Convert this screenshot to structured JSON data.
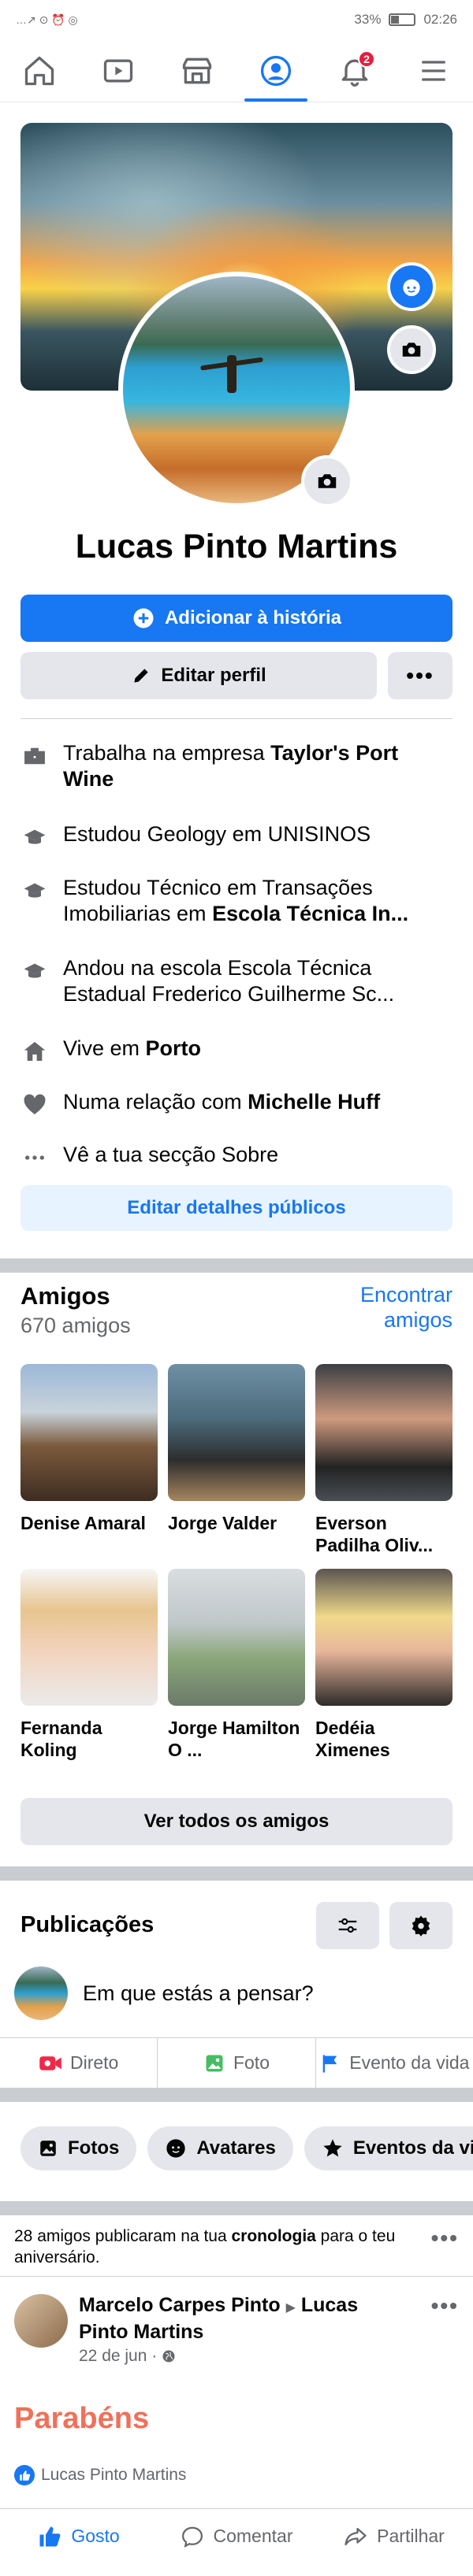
{
  "status_bar": {
    "battery": "33%",
    "time": "02:26",
    "left_icons": "…↗ ⊙ ⏰ ◎"
  },
  "nav": {
    "items": [
      {
        "name": "home",
        "icon": "home-icon"
      },
      {
        "name": "watch",
        "icon": "video-icon"
      },
      {
        "name": "marketplace",
        "icon": "shop-icon"
      },
      {
        "name": "profile",
        "icon": "profile-icon",
        "active": true
      },
      {
        "name": "notifications",
        "icon": "bell-icon",
        "badge": "2"
      },
      {
        "name": "menu",
        "icon": "hamburger-icon"
      }
    ]
  },
  "profile": {
    "name": "Lucas Pinto Martins",
    "add_story_label": "Adicionar à história",
    "edit_profile_label": "Editar perfil",
    "more_label": "•••"
  },
  "details": {
    "work": {
      "prefix": "Trabalha na empresa ",
      "bold": "Taylor's Port Wine"
    },
    "study1": {
      "prefix": "Estudou Geology em UNISINOS",
      "bold": ""
    },
    "study2": {
      "prefix": "Estudou Técnico em Transações Imobiliarias em ",
      "bold": "Escola Técnica In..."
    },
    "school": {
      "prefix": "Andou na escola Escola Técnica Estadual Frederico Guilherme Sc...",
      "bold": ""
    },
    "lives": {
      "prefix": "Vive em ",
      "bold": "Porto"
    },
    "relationship": {
      "prefix": "Numa relação com ",
      "bold": "Michelle Huff"
    },
    "about": {
      "prefix": "Vê a tua secção Sobre",
      "bold": ""
    },
    "edit_public_label": "Editar detalhes públicos"
  },
  "friends": {
    "title": "Amigos",
    "count": "670 amigos",
    "find_label": "Encontrar amigos",
    "list": [
      {
        "name": "Denise Amaral"
      },
      {
        "name": "Jorge Valder"
      },
      {
        "name": "Everson Padilha Oliv..."
      },
      {
        "name": "Fernanda Koling"
      },
      {
        "name": "Jorge Hamilton O ..."
      },
      {
        "name": "Dedéia Ximenes"
      }
    ],
    "see_all_label": "Ver todos os amigos"
  },
  "posts": {
    "title": "Publicações",
    "composer_placeholder": "Em que estás a pensar?",
    "actions": [
      {
        "label": "Direto",
        "icon": "live-icon",
        "color": "#f02849"
      },
      {
        "label": "Foto",
        "icon": "photo-icon",
        "color": "#45bd62"
      },
      {
        "label": "Evento da vida",
        "icon": "flag-icon",
        "color": "#1877f2"
      }
    ],
    "chips": [
      {
        "label": "Fotos",
        "icon": "photos-icon"
      },
      {
        "label": "Avatares",
        "icon": "avatar-icon"
      },
      {
        "label": "Eventos da vida",
        "icon": "star-icon"
      }
    ]
  },
  "timeline_note": {
    "prefix": "28 amigos publicaram na tua ",
    "bold": "cronologia",
    "suffix": " para o teu aniversário."
  },
  "post": {
    "author": "Marcelo Carpes Pinto",
    "arrow": "▶",
    "target": "Lucas Pinto Martins",
    "date": "22 de jun · ",
    "title": "Parabéns",
    "liked_by": "Lucas Pinto Martins",
    "like_label": "Gosto",
    "comment_label": "Comentar",
    "share_label": "Partilhar"
  }
}
